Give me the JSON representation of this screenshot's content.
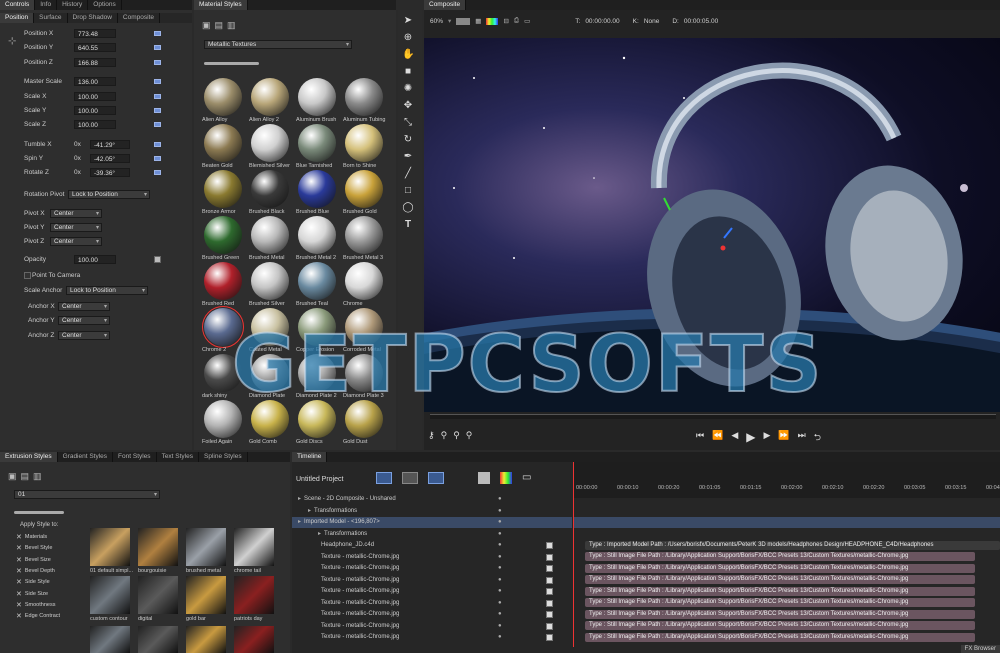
{
  "controls": {
    "tabs": [
      "Controls",
      "Info",
      "History",
      "Options"
    ],
    "subtabs": [
      "Position",
      "Surface",
      "Drop Shadow",
      "Composite"
    ],
    "fields": [
      {
        "label": "Position X",
        "value": "773.48"
      },
      {
        "label": "Position Y",
        "value": "640.55"
      },
      {
        "label": "Position Z",
        "value": "166.88"
      },
      {
        "label": "Master Scale",
        "value": "136.00"
      },
      {
        "label": "Scale X",
        "value": "100.00"
      },
      {
        "label": "Scale Y",
        "value": "100.00"
      },
      {
        "label": "Scale Z",
        "value": "100.00"
      }
    ],
    "rotations": [
      {
        "label": "Tumble X",
        "turns": "0x",
        "deg": "-41.29°"
      },
      {
        "label": "Spin Y",
        "turns": "0x",
        "deg": "-42.05°"
      },
      {
        "label": "Rotate Z",
        "turns": "0x",
        "deg": "-39.36°"
      }
    ],
    "rotation_pivot": {
      "label": "Rotation Pivot",
      "value": "Lock to Position"
    },
    "pivots": [
      {
        "label": "Pivot X",
        "value": "Center"
      },
      {
        "label": "Pivot Y",
        "value": "Center"
      },
      {
        "label": "Pivot Z",
        "value": "Center"
      }
    ],
    "opacity": {
      "label": "Opacity",
      "value": "100.00"
    },
    "point_to_camera": "Point To Camera",
    "scale_anchor": {
      "label": "Scale Anchor",
      "value": "Lock to Position"
    },
    "anchors": [
      {
        "label": "Anchor X",
        "value": "Center"
      },
      {
        "label": "Anchor Y",
        "value": "Center"
      },
      {
        "label": "Anchor Z",
        "value": "Center"
      }
    ]
  },
  "materials": {
    "tab": "Material Styles",
    "dropdown": "Metallic Textures",
    "items": [
      {
        "name": "Alien Alloy",
        "color": "#9b8d6a"
      },
      {
        "name": "Alien Alloy 2",
        "color": "#b8a679"
      },
      {
        "name": "Aluminum Brush",
        "color": "#c8c8c8"
      },
      {
        "name": "Aluminum Tubing",
        "color": "#8a8a8a"
      },
      {
        "name": "Beaten Gold",
        "color": "#8c7a52"
      },
      {
        "name": "Blemished Silver",
        "color": "#d0d0d0"
      },
      {
        "name": "Blue Tarnished",
        "color": "#7a8a7a"
      },
      {
        "name": "Born to Shine",
        "color": "#d4c07a"
      },
      {
        "name": "Bronze Armor",
        "color": "#8a7a30"
      },
      {
        "name": "Brushed Black",
        "color": "#3a3a3a"
      },
      {
        "name": "Brushed Blue",
        "color": "#2a3a9a"
      },
      {
        "name": "Brushed Gold",
        "color": "#c9a23a"
      },
      {
        "name": "Brushed Green",
        "color": "#2e6a2e"
      },
      {
        "name": "Brushed Metal",
        "color": "#b8b8b8"
      },
      {
        "name": "Brushed Metal 2",
        "color": "#d6d6d6"
      },
      {
        "name": "Brushed Metal 3",
        "color": "#9a9a9a"
      },
      {
        "name": "Brushed Red",
        "color": "#b0202a"
      },
      {
        "name": "Brushed Silver",
        "color": "#c4c4c4"
      },
      {
        "name": "Brushed Teal",
        "color": "#6a8aa0"
      },
      {
        "name": "Chrome",
        "color": "#d8d8d8"
      },
      {
        "name": "Chrome 2",
        "color": "#5a6a90"
      },
      {
        "name": "Coated Metal",
        "color": "#c8c0a0"
      },
      {
        "name": "Copper Erosion",
        "color": "#8a9a7a"
      },
      {
        "name": "Corroded Metal",
        "color": "#b09a7a"
      },
      {
        "name": "dark shiny",
        "color": "#4a4a4a"
      },
      {
        "name": "Diamond Plate",
        "color": "#9a9a9a"
      },
      {
        "name": "Diamond Plate 2",
        "color": "#aaaaaa"
      },
      {
        "name": "Diamond Plate 3",
        "color": "#8a8a8a"
      },
      {
        "name": "Foiled Again",
        "color": "#b4b4b4"
      },
      {
        "name": "Gold Comb",
        "color": "#c8b24a"
      },
      {
        "name": "Gold Discs",
        "color": "#c8b85a"
      },
      {
        "name": "Gold Dust",
        "color": "#b8a24a"
      }
    ]
  },
  "composite": {
    "tab": "Composite",
    "zoom": "60%",
    "t_label": "T:",
    "t_value": "00:00:00.00",
    "k_label": "K:",
    "k_value": "None",
    "d_label": "D:",
    "d_value": "00:00:05.00"
  },
  "extrusion": {
    "tabs": [
      "Extrusion Styles",
      "Gradient Styles",
      "Font Styles",
      "Text Styles",
      "Spline Styles"
    ],
    "dropdown": "01",
    "apply_label": "Apply Style to:",
    "checks": [
      "Materials",
      "Bevel Style",
      "Bevel Size",
      "Bevel Depth",
      "Side Style",
      "Side Size",
      "Smoothness",
      "Edge Contract"
    ],
    "thumbs": [
      {
        "name": "01 default simpl..."
      },
      {
        "name": "bourgouisie"
      },
      {
        "name": "brushed metal"
      },
      {
        "name": "chrome tail"
      },
      {
        "name": "custom contour"
      },
      {
        "name": "digital"
      },
      {
        "name": "gold bar"
      },
      {
        "name": "patriots day"
      }
    ]
  },
  "timeline": {
    "tab": "Timeline",
    "project": "Untitled Project",
    "ticks": [
      "00:00:00",
      "00:00:10",
      "00:00:20",
      "00:01:05",
      "00:01:15",
      "00:02:00",
      "00:02:10",
      "00:02:20",
      "00:03:05",
      "00:03:15",
      "00:04:00"
    ],
    "layers": [
      {
        "name": "Scene - 2D Composite - Unshared",
        "indent": 0
      },
      {
        "name": "Transformations",
        "indent": 1
      },
      {
        "name": "Imported Model - <196,807>",
        "indent": 0
      },
      {
        "name": "Transformations",
        "indent": 2
      },
      {
        "name": "Headphone_JD.c4d",
        "indent": 2
      },
      {
        "name": "Texture - metallic-Chrome.jpg",
        "indent": 2
      },
      {
        "name": "Texture - metallic-Chrome.jpg",
        "indent": 2
      },
      {
        "name": "Texture - metallic-Chrome.jpg",
        "indent": 2
      },
      {
        "name": "Texture - metallic-Chrome.jpg",
        "indent": 2
      },
      {
        "name": "Texture - metallic-Chrome.jpg",
        "indent": 2
      },
      {
        "name": "Texture - metallic-Chrome.jpg",
        "indent": 2
      },
      {
        "name": "Texture - metallic-Chrome.jpg",
        "indent": 2
      },
      {
        "name": "Texture - metallic-Chrome.jpg",
        "indent": 2
      }
    ],
    "tracks": [
      "Type : Imported Model     Path : /Users/borisfx/Documents/PeterK 3D models/Headphones Design/HEADPHONE_C4D/Headphones",
      "Type : Still Image File     Path : /Library/Application Support/BorisFX/BCC Presets 13/Custom Textures/metallic-Chrome.jpg",
      "Type : Still Image File     Path : /Library/Application Support/BorisFX/BCC Presets 13/Custom Textures/metallic-Chrome.jpg",
      "Type : Still Image File     Path : /Library/Application Support/BorisFX/BCC Presets 13/Custom Textures/metallic-Chrome.jpg",
      "Type : Still Image File     Path : /Library/Application Support/BorisFX/BCC Presets 13/Custom Textures/metallic-Chrome.jpg",
      "Type : Still Image File     Path : /Library/Application Support/BorisFX/BCC Presets 13/Custom Textures/metallic-Chrome.jpg",
      "Type : Still Image File     Path : /Library/Application Support/BorisFX/BCC Presets 13/Custom Textures/metallic-Chrome.jpg",
      "Type : Still Image File     Path : /Library/Application Support/BorisFX/BCC Presets 13/Custom Textures/metallic-Chrome.jpg",
      "Type : Still Image File     Path : /Library/Application Support/BorisFX/BCC Presets 13/Custom Textures/metallic-Chrome.jpg"
    ],
    "fx_browser": "FX Browser"
  },
  "watermark": "GETPCSOFTS"
}
